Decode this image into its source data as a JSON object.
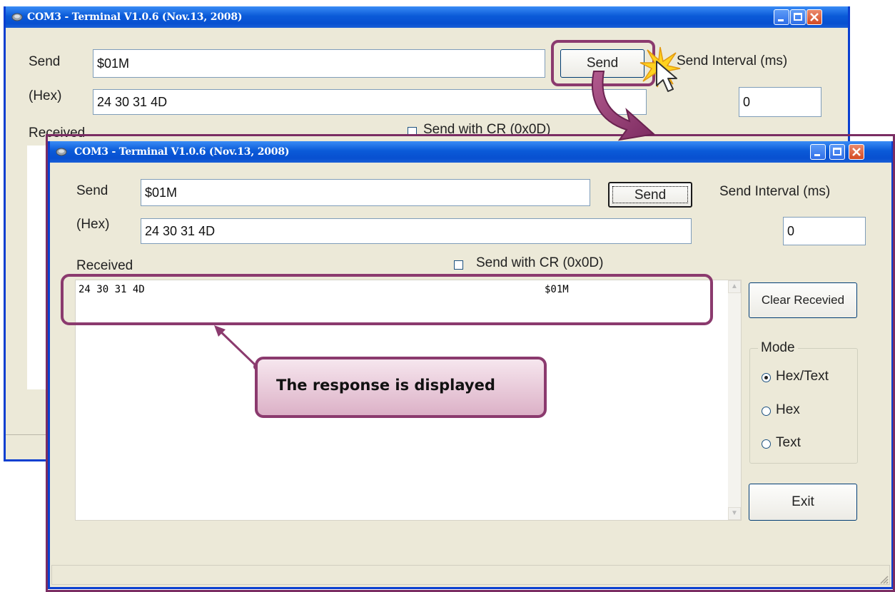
{
  "back_window": {
    "title": "COM3 - Terminal V1.0.6 (Nov.13, 2008)",
    "send_label": "Send",
    "send_value": "$01M",
    "hex_label": "(Hex)",
    "hex_value": "24 30 31 4D",
    "send_button": "Send",
    "interval_label": "Send Interval (ms)",
    "interval_value": "0",
    "received_label": "Received",
    "cr_label": "Send with CR (0x0D)"
  },
  "front_window": {
    "title": "COM3 - Terminal V1.0.6 (Nov.13, 2008)",
    "send_label": "Send",
    "send_value": "$01M",
    "hex_label": "(Hex)",
    "hex_value": "24 30 31 4D",
    "send_button": "Send",
    "interval_label": "Send Interval (ms)",
    "interval_value": "0",
    "received_label": "Received",
    "cr_label": "Send with CR (0x0D)",
    "received_hex": "24 30 31 4D",
    "received_text": "$01M",
    "clear_button": "Clear Recevied",
    "mode_label": "Mode",
    "mode_options": [
      "Hex/Text",
      "Hex",
      "Text"
    ],
    "mode_selected": "Hex/Text",
    "exit_button": "Exit"
  },
  "callout": {
    "text": "The response is displayed"
  },
  "colors": {
    "titlebar": "#0a5ad8",
    "annotation_border": "#8b3a6e",
    "callout_fill": "#e8c2d6"
  }
}
